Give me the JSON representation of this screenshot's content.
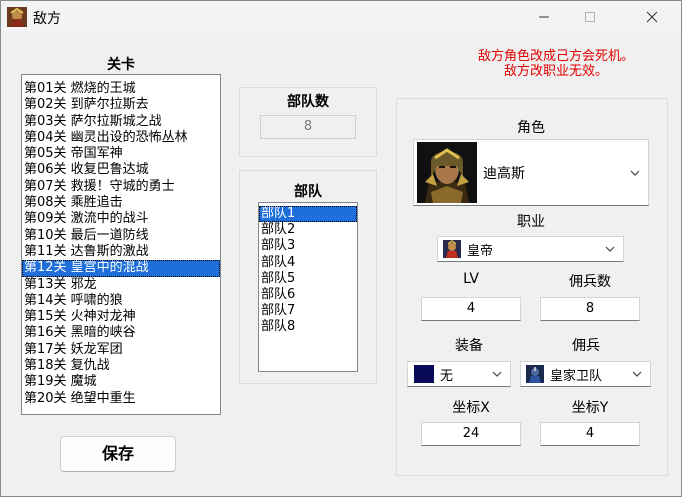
{
  "window": {
    "title": "敌方"
  },
  "stage_list": {
    "label": "关卡",
    "items": [
      "第01关 燃烧的王城",
      "第02关 到萨尔拉斯去",
      "第03关 萨尔拉斯城之战",
      "第04关 幽灵出设的恐怖丛林",
      "第05关 帝国军神",
      "第06关 收复巴鲁达城",
      "第07关 救援！守城的勇士",
      "第08关 乘胜追击",
      "第09关 激流中的战斗",
      "第10关 最后一道防线",
      "第11关 达鲁斯的激战",
      "第12关 皇宫中的混战",
      "第13关 邪龙",
      "第14关 呼啸的狼",
      "第15关 火神对龙神",
      "第16关 黑暗的峡谷",
      "第17关 妖龙军团",
      "第18关 复仇战",
      "第19关 魔城",
      "第20关 绝望中重生"
    ],
    "selected_index": 11
  },
  "save_button": "保存",
  "troop_count": {
    "label": "部队数",
    "value": "8"
  },
  "troop_list": {
    "label": "部队",
    "items": [
      "部队1",
      "部队2",
      "部队3",
      "部队4",
      "部队5",
      "部队6",
      "部队7",
      "部队8"
    ],
    "selected_index": 0
  },
  "warning": {
    "line1": "敌方角色改成己方会死机。",
    "line2": "敌方改职业无效。"
  },
  "character": {
    "label": "角色",
    "value": "迪高斯"
  },
  "job": {
    "label": "职业",
    "value": "皇帝"
  },
  "lv": {
    "label": "LV",
    "value": "4"
  },
  "mercenary_count": {
    "label": "佣兵数",
    "value": "8"
  },
  "equipment": {
    "label": "装备",
    "value": "无",
    "swatch_color": "#0a0a5a"
  },
  "mercenary": {
    "label": "佣兵",
    "value": "皇家卫队"
  },
  "coord_x": {
    "label": "坐标X",
    "value": "24"
  },
  "coord_y": {
    "label": "坐标Y",
    "value": "4"
  },
  "colors": {
    "selection": "#1e6fd9",
    "warning": "#e00000"
  }
}
